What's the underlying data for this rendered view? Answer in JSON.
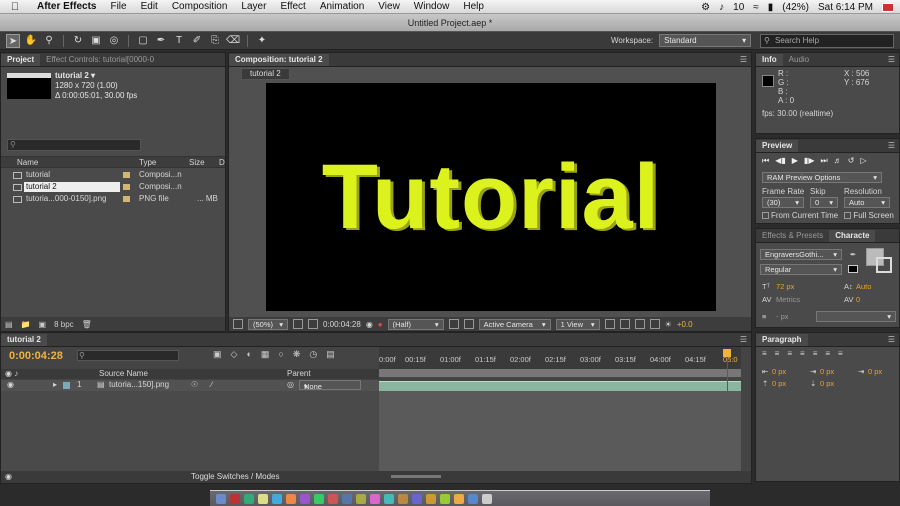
{
  "menubar": {
    "app": "After Effects",
    "items": [
      "File",
      "Edit",
      "Composition",
      "Layer",
      "Effect",
      "Animation",
      "View",
      "Window",
      "Help"
    ],
    "status": {
      "volume": "10",
      "battery": "(42%)",
      "clock": "Sat 6:14 PM"
    }
  },
  "window": {
    "title": "Untitled Project.aep *"
  },
  "toolbar": {
    "workspace_label": "Workspace:",
    "workspace_value": "Standard",
    "help_placeholder": "Search Help"
  },
  "project": {
    "tabs": [
      "Project",
      "Effect Controls: tutorial[0000-0"
    ],
    "item_name": "tutorial 2 ▾",
    "item_size": "1280 x 720 (1.00)",
    "item_duration": "Δ 0:00:05:01, 30.00 fps",
    "search_placeholder": "",
    "columns": {
      "name": "Name",
      "type": "Type",
      "size": "Size",
      "dur": "D"
    },
    "rows": [
      {
        "name": "tutorial",
        "type": "Composi...n",
        "size": ""
      },
      {
        "name": "tutorial 2",
        "type": "Composi...n",
        "size": ""
      },
      {
        "name": "tutoria...000-0150].png",
        "type": "PNG file",
        "size": "... MB"
      }
    ],
    "bpc": "8 bpc"
  },
  "composition": {
    "tab": "Composition: tutorial 2",
    "subtab": "tutorial 2",
    "viewer_text": "Tutorial",
    "zoom": "(50%)",
    "timecode": "0:00:04:28",
    "resolution": "(Half)",
    "camera": "Active Camera",
    "views": "1 View",
    "exposure": "+0.0"
  },
  "info": {
    "tabs": [
      "Info",
      "Audio"
    ],
    "r": "R :",
    "g": "G :",
    "b": "B :",
    "a": "A : 0",
    "x": "X : 506",
    "y": "Y : 676",
    "fps": "fps: 30.00 (realtime)"
  },
  "preview": {
    "tab": "Preview",
    "ram_options": "RAM Preview Options",
    "frame_rate_label": "Frame Rate",
    "skip_label": "Skip",
    "resolution_label": "Resolution",
    "frame_rate": "(30)",
    "skip": "0",
    "resolution": "Auto",
    "from_current": "From Current Time",
    "full_screen": "Full Screen"
  },
  "character": {
    "tabs": [
      "Effects & Presets",
      "Characte"
    ],
    "font": "EngraversGothi...",
    "style": "Regular",
    "size": "72 px",
    "leading": "Auto",
    "kerning": "Metrics",
    "tracking": "0",
    "stroke": "- px"
  },
  "paragraph": {
    "tab": "Paragraph",
    "indent_values": [
      "0 px",
      "0 px",
      "0 px",
      "0 px",
      "0 px"
    ]
  },
  "timeline": {
    "tab": "tutorial 2",
    "timecode": "0:00:04:28",
    "columns": {
      "source": "Source Name",
      "parent": "Parent"
    },
    "layer": {
      "index": "1",
      "name": "tutoria...150].png",
      "parent": "None"
    },
    "ticks": [
      "0:00f",
      "00:15f",
      "01:00f",
      "01:15f",
      "02:00f",
      "02:15f",
      "03:00f",
      "03:15f",
      "04:00f",
      "04:15f",
      "05:0"
    ],
    "toggle": "Toggle Switches / Modes",
    "track_color": "#8ab6a0",
    "playhead_color": "#dd2222",
    "playhead_position_seconds": 4.93
  }
}
